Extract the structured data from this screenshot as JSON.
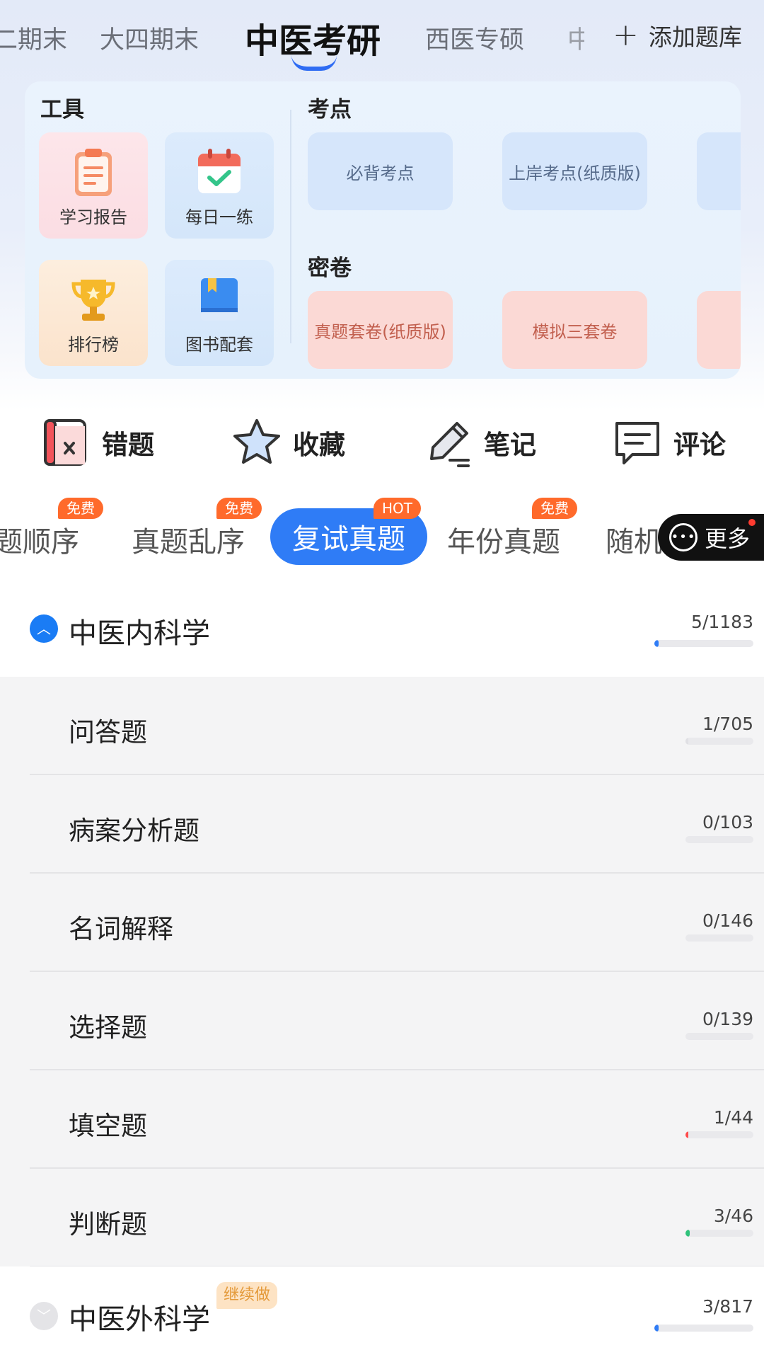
{
  "top_tabs": [
    "大四期末",
    "中医考研",
    "西医专硕"
  ],
  "top_tabs_edge_left": "二期末",
  "top_tabs_edge_right": "中",
  "add_library": "添加题库",
  "panel": {
    "tools_title": "工具",
    "tools": [
      {
        "label": "学习报告",
        "icon": "clipboard-report-icon"
      },
      {
        "label": "每日一练",
        "icon": "calendar-check-icon"
      },
      {
        "label": "排行榜",
        "icon": "trophy-icon"
      },
      {
        "label": "图书配套",
        "icon": "book-icon"
      }
    ],
    "kaodian_title": "考点",
    "kaodian": [
      "必背考点",
      "上岸考点(纸质版)"
    ],
    "mijuan_title": "密卷",
    "mijuan": [
      "真题套卷(纸质版)",
      "模拟三套卷"
    ]
  },
  "quick_actions": [
    {
      "label": "错题",
      "icon": "wrong-book-icon"
    },
    {
      "label": "收藏",
      "icon": "star-icon"
    },
    {
      "label": "笔记",
      "icon": "pencil-note-icon"
    },
    {
      "label": "评论",
      "icon": "comment-icon"
    }
  ],
  "mode_tabs": {
    "items": [
      "题顺序",
      "真题乱序",
      "复试真题",
      "年份真题",
      "随机"
    ],
    "badges": [
      "免费",
      "免费",
      "HOT",
      "免费"
    ],
    "active": "复试真题",
    "more": "更多"
  },
  "chapters": [
    {
      "title": "中医内科学",
      "count": "5/1183",
      "progress": 0.004,
      "expanded": true,
      "subitems": [
        {
          "title": "问答题",
          "count": "1/705",
          "progress": 0.001,
          "color": "#e0e0e4"
        },
        {
          "title": "病案分析题",
          "count": "0/103",
          "progress": 0,
          "color": "#e0e0e4"
        },
        {
          "title": "名词解释",
          "count": "0/146",
          "progress": 0,
          "color": "#e0e0e4"
        },
        {
          "title": "选择题",
          "count": "0/139",
          "progress": 0,
          "color": "#e0e0e4"
        },
        {
          "title": "填空题",
          "count": "1/44",
          "progress": 0.023,
          "color": "#ff4b4b"
        },
        {
          "title": "判断题",
          "count": "3/46",
          "progress": 0.065,
          "color": "#2fc27a"
        }
      ]
    },
    {
      "title": "中医外科学",
      "count": "3/817",
      "progress": 0.004,
      "expanded": false,
      "badge": "继续做"
    }
  ],
  "colors": {
    "accent": "#2f7cf6",
    "hot_badge": "#ff6a2b"
  }
}
